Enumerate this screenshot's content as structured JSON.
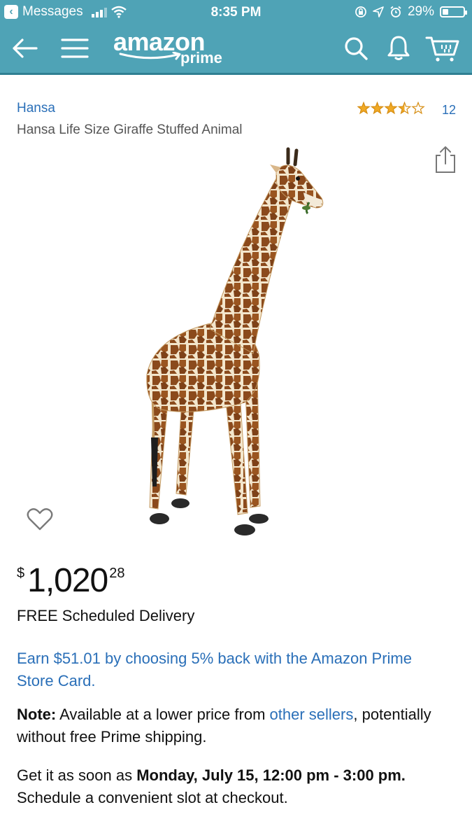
{
  "status_bar": {
    "back_app": "Messages",
    "time": "8:35 PM",
    "battery_percent": "29%",
    "battery_level": 0.29
  },
  "header": {
    "logo_word": "amazon",
    "logo_sub": "prime",
    "accent": "#4fa3b6",
    "icons": [
      "back-arrow-icon",
      "hamburger-menu-icon",
      "search-icon",
      "bell-icon",
      "cart-icon"
    ]
  },
  "product": {
    "brand": "Hansa",
    "title": "Hansa Life Size Giraffe Stuffed Animal",
    "rating_stars": 3.5,
    "rating_count": "12",
    "image_label": "giraffe"
  },
  "price": {
    "currency": "$",
    "whole": "1,020",
    "cents": "28"
  },
  "delivery": "FREE Scheduled Delivery",
  "promo": "Earn $51.01 by choosing 5% back with the Amazon Prime Store Card.",
  "note": {
    "label": "Note:",
    "text_before": " Available at a lower price from ",
    "link": "other sellers",
    "text_after": ", potentially without free Prime shipping."
  },
  "eta": {
    "prefix": "Get it as soon as ",
    "date": "Monday, July 15, 12:00 pm - 3:00 pm.",
    "suffix": " Schedule a convenient slot at checkout."
  }
}
